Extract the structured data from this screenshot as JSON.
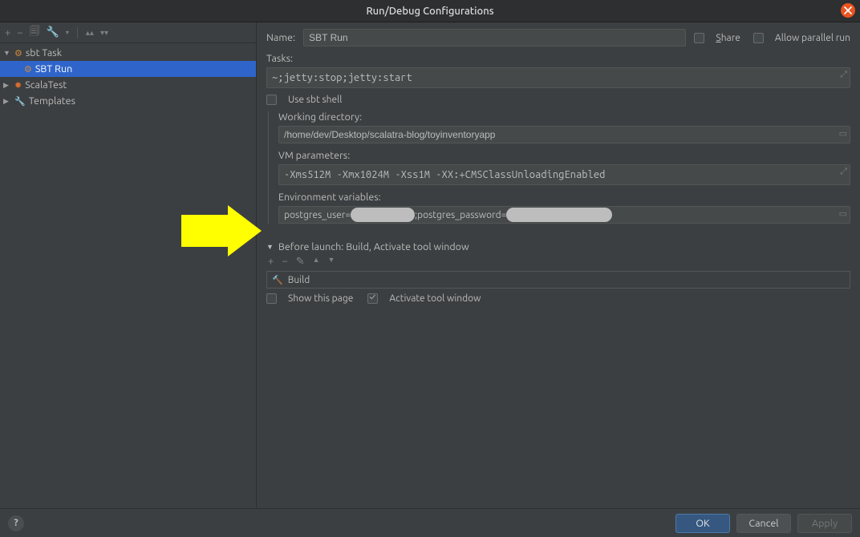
{
  "window": {
    "title": "Run/Debug Configurations"
  },
  "tree": {
    "sbtTask": "sbt Task",
    "sbtRun": "SBT Run",
    "scalaTest": "ScalaTest",
    "templates": "Templates"
  },
  "form": {
    "name_label": "Name:",
    "name_value": "SBT Run",
    "share_label": "Share",
    "allow_parallel_label": "Allow parallel run",
    "tasks_label": "Tasks:",
    "tasks_value": "~;jetty:stop;jetty:start",
    "use_sbt_shell": "Use sbt shell",
    "wd_label": "Working directory:",
    "wd_value": "/home/dev/Desktop/scalatra-blog/toyinventoryapp",
    "vm_label": "VM parameters:",
    "vm_value": "-Xms512M -Xmx1024M -Xss1M -XX:+CMSClassUnloadingEnabled",
    "env_label": "Environment variables:",
    "env_prefix1": "postgres_user=",
    "env_mid": ";postgres_password="
  },
  "before_launch": {
    "title": "Before launch: Build, Activate tool window",
    "build": "Build",
    "show_this_page": "Show this page",
    "activate_tool": "Activate tool window"
  },
  "footer": {
    "ok": "OK",
    "cancel": "Cancel",
    "apply": "Apply"
  }
}
